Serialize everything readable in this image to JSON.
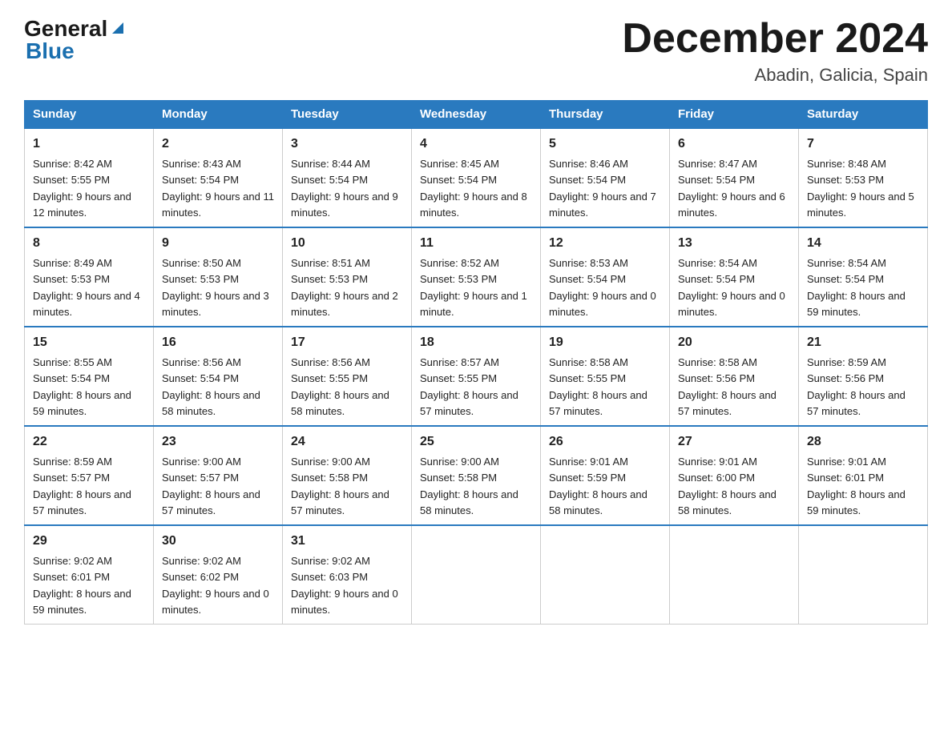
{
  "header": {
    "logo_general": "General",
    "logo_blue": "Blue",
    "month_title": "December 2024",
    "location": "Abadin, Galicia, Spain"
  },
  "days_of_week": [
    "Sunday",
    "Monday",
    "Tuesday",
    "Wednesday",
    "Thursday",
    "Friday",
    "Saturday"
  ],
  "weeks": [
    [
      {
        "num": "1",
        "sunrise": "8:42 AM",
        "sunset": "5:55 PM",
        "daylight": "9 hours and 12 minutes."
      },
      {
        "num": "2",
        "sunrise": "8:43 AM",
        "sunset": "5:54 PM",
        "daylight": "9 hours and 11 minutes."
      },
      {
        "num": "3",
        "sunrise": "8:44 AM",
        "sunset": "5:54 PM",
        "daylight": "9 hours and 9 minutes."
      },
      {
        "num": "4",
        "sunrise": "8:45 AM",
        "sunset": "5:54 PM",
        "daylight": "9 hours and 8 minutes."
      },
      {
        "num": "5",
        "sunrise": "8:46 AM",
        "sunset": "5:54 PM",
        "daylight": "9 hours and 7 minutes."
      },
      {
        "num": "6",
        "sunrise": "8:47 AM",
        "sunset": "5:54 PM",
        "daylight": "9 hours and 6 minutes."
      },
      {
        "num": "7",
        "sunrise": "8:48 AM",
        "sunset": "5:53 PM",
        "daylight": "9 hours and 5 minutes."
      }
    ],
    [
      {
        "num": "8",
        "sunrise": "8:49 AM",
        "sunset": "5:53 PM",
        "daylight": "9 hours and 4 minutes."
      },
      {
        "num": "9",
        "sunrise": "8:50 AM",
        "sunset": "5:53 PM",
        "daylight": "9 hours and 3 minutes."
      },
      {
        "num": "10",
        "sunrise": "8:51 AM",
        "sunset": "5:53 PM",
        "daylight": "9 hours and 2 minutes."
      },
      {
        "num": "11",
        "sunrise": "8:52 AM",
        "sunset": "5:53 PM",
        "daylight": "9 hours and 1 minute."
      },
      {
        "num": "12",
        "sunrise": "8:53 AM",
        "sunset": "5:54 PM",
        "daylight": "9 hours and 0 minutes."
      },
      {
        "num": "13",
        "sunrise": "8:54 AM",
        "sunset": "5:54 PM",
        "daylight": "9 hours and 0 minutes."
      },
      {
        "num": "14",
        "sunrise": "8:54 AM",
        "sunset": "5:54 PM",
        "daylight": "8 hours and 59 minutes."
      }
    ],
    [
      {
        "num": "15",
        "sunrise": "8:55 AM",
        "sunset": "5:54 PM",
        "daylight": "8 hours and 59 minutes."
      },
      {
        "num": "16",
        "sunrise": "8:56 AM",
        "sunset": "5:54 PM",
        "daylight": "8 hours and 58 minutes."
      },
      {
        "num": "17",
        "sunrise": "8:56 AM",
        "sunset": "5:55 PM",
        "daylight": "8 hours and 58 minutes."
      },
      {
        "num": "18",
        "sunrise": "8:57 AM",
        "sunset": "5:55 PM",
        "daylight": "8 hours and 57 minutes."
      },
      {
        "num": "19",
        "sunrise": "8:58 AM",
        "sunset": "5:55 PM",
        "daylight": "8 hours and 57 minutes."
      },
      {
        "num": "20",
        "sunrise": "8:58 AM",
        "sunset": "5:56 PM",
        "daylight": "8 hours and 57 minutes."
      },
      {
        "num": "21",
        "sunrise": "8:59 AM",
        "sunset": "5:56 PM",
        "daylight": "8 hours and 57 minutes."
      }
    ],
    [
      {
        "num": "22",
        "sunrise": "8:59 AM",
        "sunset": "5:57 PM",
        "daylight": "8 hours and 57 minutes."
      },
      {
        "num": "23",
        "sunrise": "9:00 AM",
        "sunset": "5:57 PM",
        "daylight": "8 hours and 57 minutes."
      },
      {
        "num": "24",
        "sunrise": "9:00 AM",
        "sunset": "5:58 PM",
        "daylight": "8 hours and 57 minutes."
      },
      {
        "num": "25",
        "sunrise": "9:00 AM",
        "sunset": "5:58 PM",
        "daylight": "8 hours and 58 minutes."
      },
      {
        "num": "26",
        "sunrise": "9:01 AM",
        "sunset": "5:59 PM",
        "daylight": "8 hours and 58 minutes."
      },
      {
        "num": "27",
        "sunrise": "9:01 AM",
        "sunset": "6:00 PM",
        "daylight": "8 hours and 58 minutes."
      },
      {
        "num": "28",
        "sunrise": "9:01 AM",
        "sunset": "6:01 PM",
        "daylight": "8 hours and 59 minutes."
      }
    ],
    [
      {
        "num": "29",
        "sunrise": "9:02 AM",
        "sunset": "6:01 PM",
        "daylight": "8 hours and 59 minutes."
      },
      {
        "num": "30",
        "sunrise": "9:02 AM",
        "sunset": "6:02 PM",
        "daylight": "9 hours and 0 minutes."
      },
      {
        "num": "31",
        "sunrise": "9:02 AM",
        "sunset": "6:03 PM",
        "daylight": "9 hours and 0 minutes."
      },
      null,
      null,
      null,
      null
    ]
  ]
}
